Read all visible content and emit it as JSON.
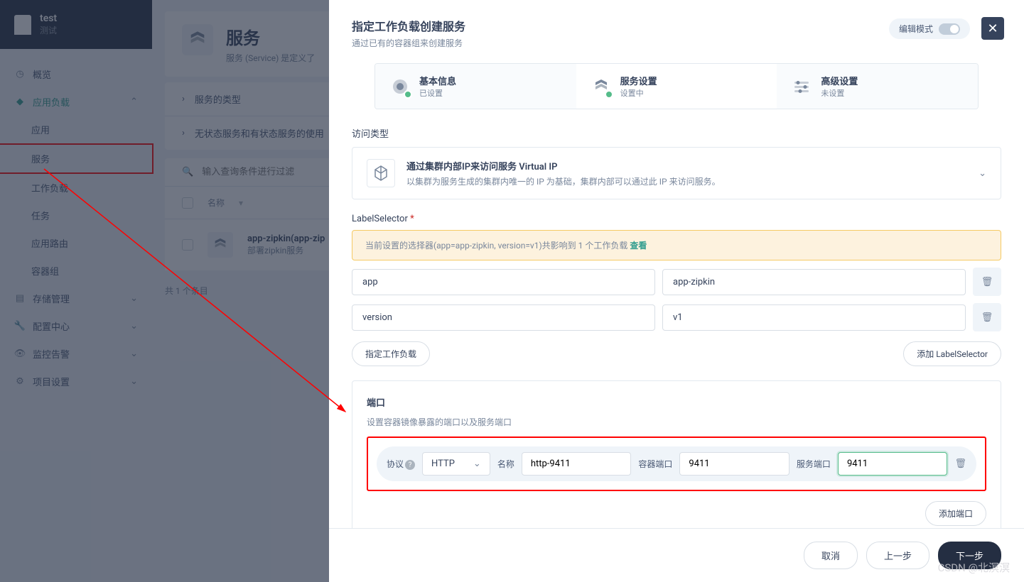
{
  "project": {
    "title": "test",
    "subtitle": "测试"
  },
  "nav": {
    "overview": "概览",
    "workload": "应用负载",
    "app": "应用",
    "service": "服务",
    "workloads": "工作负载",
    "tasks": "任务",
    "routes": "应用路由",
    "pods": "容器组",
    "storage": "存储管理",
    "config": "配置中心",
    "monitor": "监控告警",
    "settings": "项目设置"
  },
  "page": {
    "title": "服务",
    "subtitle": "服务 (Service) 是定义了"
  },
  "accordion": {
    "type": "服务的类型",
    "usage": "无状态服务和有状态服务的使用"
  },
  "search": {
    "placeholder": "输入查询条件进行过滤"
  },
  "table": {
    "colName": "名称",
    "rowTitle": "app-zipkin(app-zip",
    "rowSub": "部署zipkin服务"
  },
  "footer": "共 1 个条目",
  "modal": {
    "title": "指定工作负载创建服务",
    "subtitle": "通过已有的容器组来创建服务",
    "editMode": "编辑模式",
    "steps": {
      "s1t": "基本信息",
      "s1s": "已设置",
      "s2t": "服务设置",
      "s2s": "设置中",
      "s3t": "高级设置",
      "s3s": "未设置"
    },
    "accessType": "访问类型",
    "accessTitle": "通过集群内部IP来访问服务 Virtual IP",
    "accessDesc": "以集群为服务生成的集群内唯一的 IP 为基础，集群内部可以通过此 IP 来访问服务。",
    "labelSelector": "LabelSelector",
    "alertPrefix": "当前设置的选择器(app=app-zipkin, version=v1)共影响到 1 个工作负载 ",
    "alertLink": "查看",
    "kv": [
      {
        "k": "app",
        "v": "app-zipkin"
      },
      {
        "k": "version",
        "v": "v1"
      }
    ],
    "btnSpecify": "指定工作负载",
    "btnAddLabel": "添加 LabelSelector",
    "portTitle": "端口",
    "portDesc": "设置容器镜像暴露的端口以及服务端口",
    "port": {
      "protoLabel": "协议",
      "protoVal": "HTTP",
      "nameLabel": "名称",
      "nameVal": "http-9411",
      "contLabel": "容器端口",
      "contVal": "9411",
      "svcLabel": "服务端口",
      "svcVal": "9411"
    },
    "btnAddPort": "添加端口",
    "cancel": "取消",
    "prev": "上一步",
    "next": "下一步"
  },
  "watermark": "CSDN @北溟溟"
}
